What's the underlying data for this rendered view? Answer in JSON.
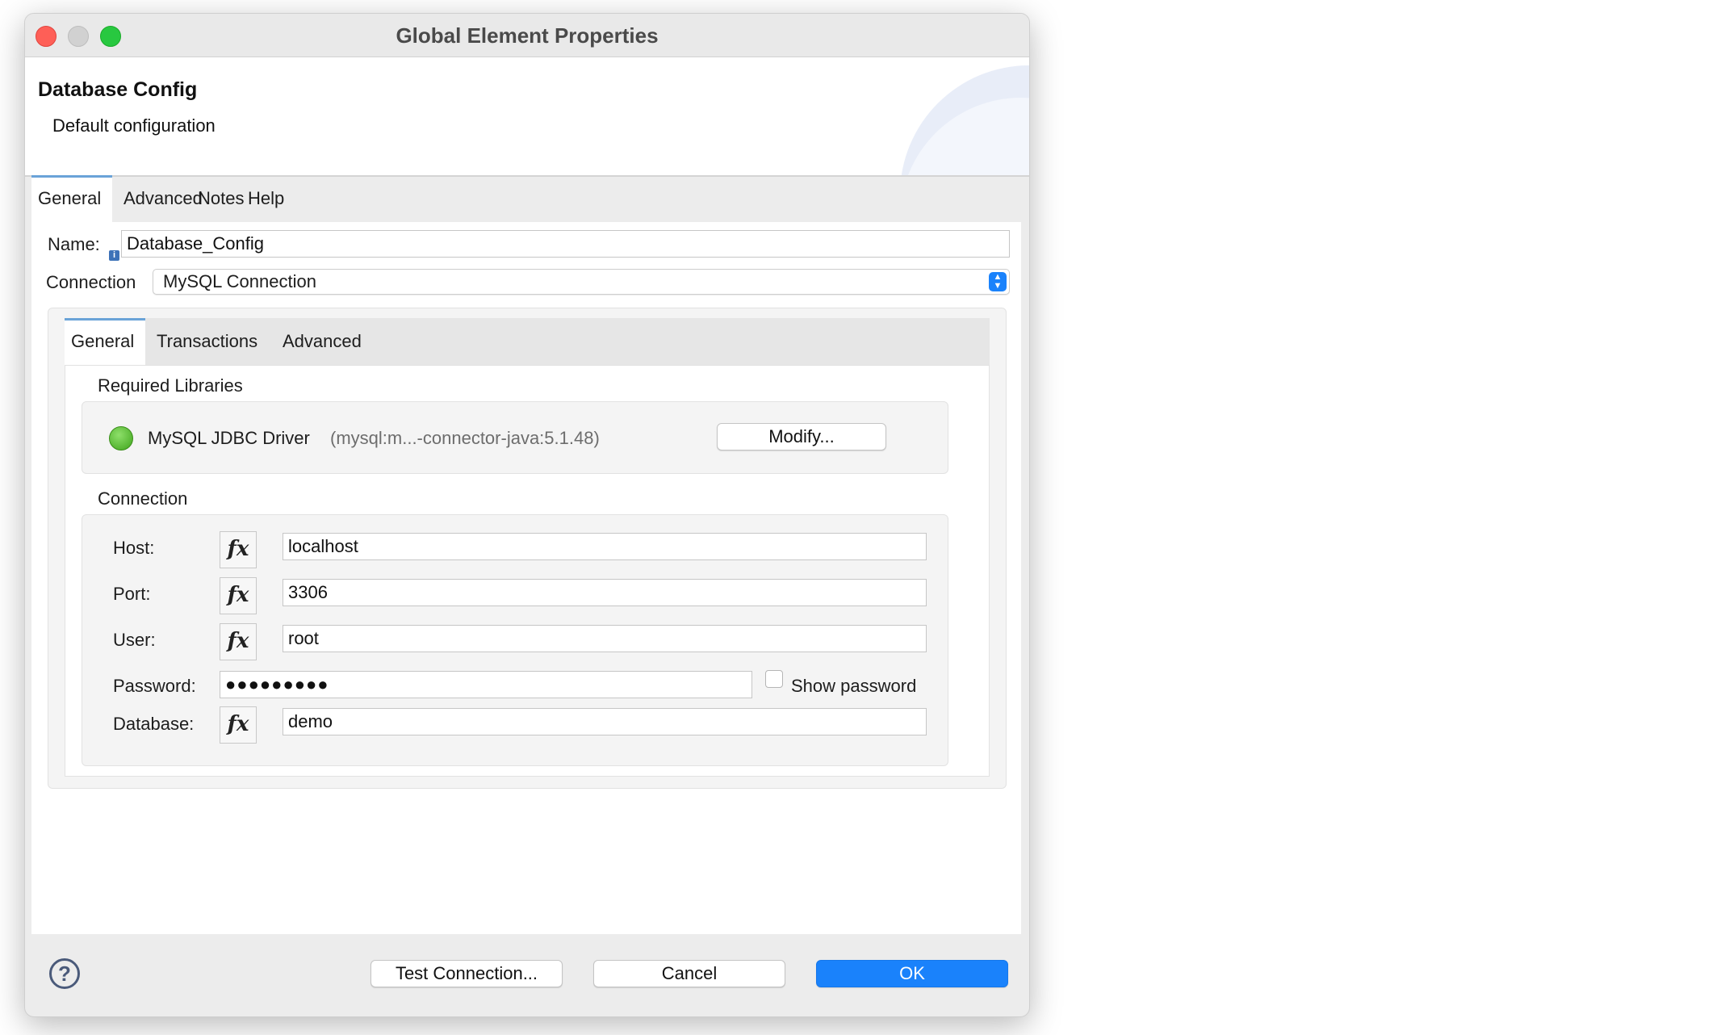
{
  "window": {
    "title": "Global Element Properties"
  },
  "header": {
    "title": "Database Config",
    "subtitle": "Default configuration"
  },
  "outer_tabs": [
    "General",
    "Advanced",
    "Notes",
    "Help"
  ],
  "form": {
    "name_label": "Name:",
    "name_value": "Database_Config",
    "connection_label": "Connection",
    "connection_value": "MySQL Connection"
  },
  "inner_tabs": [
    "General",
    "Transactions",
    "Advanced"
  ],
  "required_libraries": {
    "section_label": "Required Libraries",
    "driver_name": "MySQL JDBC Driver",
    "driver_detail": "(mysql:m...-connector-java:5.1.48)",
    "modify_button": "Modify..."
  },
  "connection": {
    "section_label": "Connection",
    "host_label": "Host:",
    "host_value": "localhost",
    "port_label": "Port:",
    "port_value": "3306",
    "user_label": "User:",
    "user_value": "root",
    "password_label": "Password:",
    "password_mask": "●●●●●●●●●",
    "show_password_label": "Show password",
    "database_label": "Database:",
    "database_value": "demo",
    "fx_label": "fx"
  },
  "footer": {
    "help_symbol": "?",
    "test_connection": "Test Connection...",
    "cancel": "Cancel",
    "ok": "OK"
  },
  "colors": {
    "accent": "#1a82fb",
    "tab_indicator": "#6aa3d8",
    "success": "#3fa41c"
  }
}
